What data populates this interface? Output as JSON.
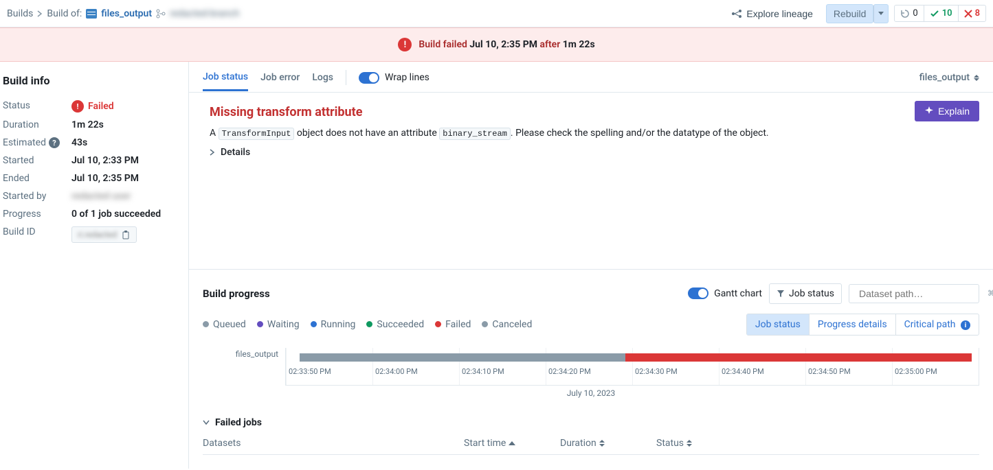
{
  "breadcrumbs": {
    "root": "Builds",
    "prefix": "Build of:",
    "dataset": "files_output",
    "branch_redacted": "redacted-branch"
  },
  "topbar": {
    "explore": "Explore lineage",
    "rebuild": "Rebuild",
    "refresh_count": "0",
    "checks_count": "10",
    "errors_count": "8"
  },
  "alert": {
    "prefix": "Build failed",
    "time": "Jul 10, 2:35 PM",
    "after_word": "after",
    "duration": "1m 22s"
  },
  "build_info": {
    "heading": "Build info",
    "status_label": "Status",
    "status_value": "Failed",
    "duration_label": "Duration",
    "duration_value": "1m 22s",
    "estimated_label": "Estimated",
    "estimated_value": "43s",
    "started_label": "Started",
    "started_value": "Jul 10, 2:33 PM",
    "ended_label": "Ended",
    "ended_value": "Jul 10, 2:35 PM",
    "started_by_label": "Started by",
    "started_by_value": "redacted user",
    "progress_label": "Progress",
    "progress_value": "0 of 1 job succeeded",
    "build_id_label": "Build ID",
    "build_id_value": "ri.redacted"
  },
  "tabs": {
    "job_status": "Job status",
    "job_error": "Job error",
    "logs": "Logs",
    "wrap_lines": "Wrap lines",
    "file_selector": "files_output"
  },
  "error": {
    "title": "Missing transform attribute",
    "pre": "A ",
    "code1": "TransformInput",
    "mid": " object does not have an attribute ",
    "code2": "binary_stream",
    "post": ". Please check the spelling and/or the datatype of the object.",
    "details": "Details",
    "explain": "Explain"
  },
  "progress": {
    "heading": "Build progress",
    "gantt_label": "Gantt chart",
    "filter_label": "Job status",
    "search_placeholder": "Dataset path…",
    "search_kbd": "⌘K",
    "legend": {
      "queued": "Queued",
      "waiting": "Waiting",
      "running": "Running",
      "succeeded": "Succeeded",
      "failed": "Failed",
      "canceled": "Canceled"
    },
    "segments": {
      "job_status": "Job status",
      "progress_details": "Progress details",
      "critical_path": "Critical path"
    },
    "gantt": {
      "row_label": "files_output",
      "ticks": [
        "02:33:50 PM",
        "02:34:00 PM",
        "02:34:10 PM",
        "02:34:20 PM",
        "02:34:30 PM",
        "02:34:40 PM",
        "02:34:50 PM",
        "02:35:00 PM"
      ],
      "date": "July 10, 2023"
    },
    "failed_jobs_heading": "Failed jobs",
    "columns": {
      "datasets": "Datasets",
      "start": "Start time",
      "duration": "Duration",
      "status": "Status"
    }
  },
  "chart_data": {
    "type": "gantt",
    "date": "July 10, 2023",
    "x_range": [
      "02:33:45 PM",
      "02:35:05 PM"
    ],
    "rows": [
      {
        "name": "files_output",
        "segments": [
          {
            "state": "queued",
            "start": "02:33:47 PM",
            "end": "02:34:27 PM"
          },
          {
            "state": "failed",
            "start": "02:34:27 PM",
            "end": "02:35:05 PM"
          }
        ]
      }
    ]
  }
}
